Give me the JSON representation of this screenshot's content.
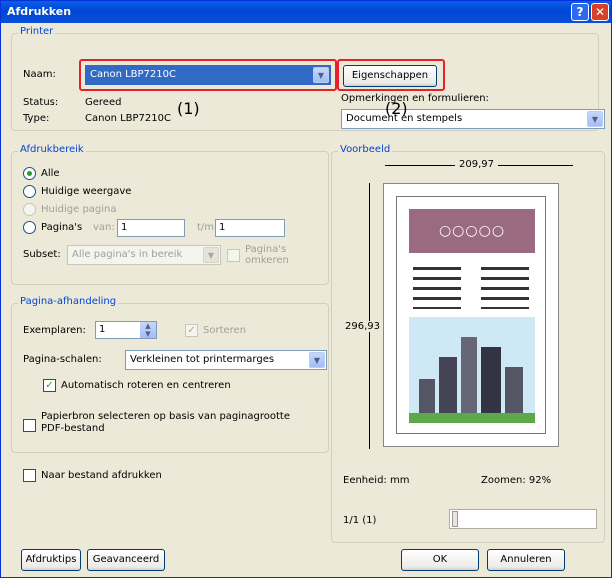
{
  "window": {
    "title": "Afdrukken",
    "help_glyph": "?",
    "close_glyph": "✕"
  },
  "printer": {
    "group_label": "Printer",
    "name_label": "Naam:",
    "name_value": "Canon LBP7210C",
    "status_label": "Status:",
    "status_value": "Gereed",
    "type_label": "Type:",
    "type_value": "Canon LBP7210C",
    "properties_button": "Eigenschappen",
    "comments_label": "Opmerkingen en formulieren:",
    "comments_value": "Document en stempels"
  },
  "print_range": {
    "group_label": "Afdrukbereik",
    "all": "Alle",
    "current_view": "Huidige weergave",
    "current_page": "Huidige pagina",
    "pages": "Pagina's",
    "from_label": "van:",
    "from_value": "1",
    "to_label": "t/m:",
    "to_value": "1",
    "subset_label": "Subset:",
    "subset_value": "Alle pagina's in bereik",
    "reverse_label": "Pagina's omkeren"
  },
  "page_handling": {
    "group_label": "Pagina-afhandeling",
    "copies_label": "Exemplaren:",
    "copies_value": "1",
    "collate_label": "Sorteren",
    "scaling_label": "Pagina-schalen:",
    "scaling_value": "Verkleinen tot printermarges",
    "auto_rotate_label": "Automatisch roteren en centreren",
    "paper_source_label": "Papierbron selecteren op basis van paginagrootte PDF-bestand"
  },
  "print_to_file_label": "Naar bestand afdrukken",
  "preview": {
    "group_label": "Voorbeeld",
    "width_value": "209,97",
    "height_value": "296,93",
    "unit_label": "Eenheid: mm",
    "zoom_label": "Zoomen: 92%",
    "page_counter": "1/1 (1)"
  },
  "buttons": {
    "advanced": "Afdruktips",
    "advanced2": "Geavanceerd",
    "ok": "OK",
    "cancel": "Annuleren"
  },
  "callouts": {
    "one": "(1)",
    "two": "(2)"
  },
  "colors": {
    "highlight": "#e8202a",
    "selection": "#316ac5",
    "groupLabel": "#0046d5"
  }
}
